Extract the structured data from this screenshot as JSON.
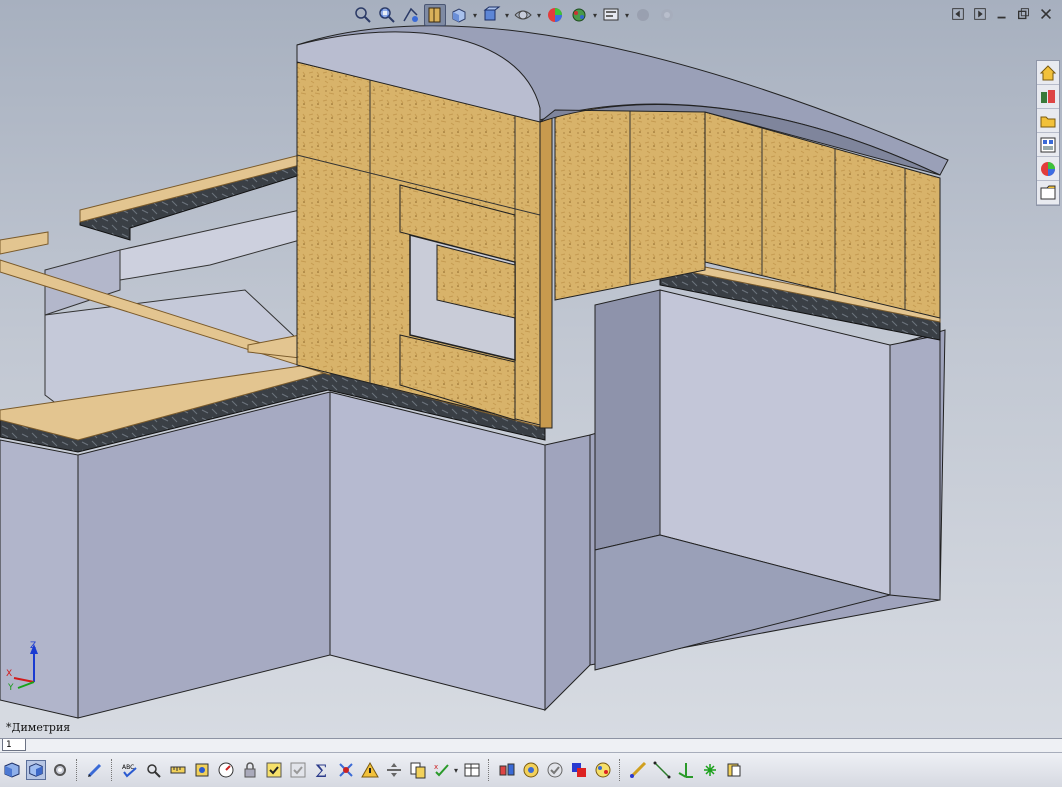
{
  "viewport": {
    "view_label": "*Диметрия",
    "triad": {
      "z": "Z",
      "x": "X",
      "y": "Y"
    }
  },
  "heads_up_toolbar": [
    {
      "icon": "zoom-to-fit-icon"
    },
    {
      "icon": "zoom-to-area-icon"
    },
    {
      "icon": "previous-view-icon"
    },
    {
      "icon": "section-view-icon",
      "active": true
    },
    {
      "icon": "view-orientation-icon",
      "dropdown": true
    },
    {
      "icon": "display-style-icon",
      "dropdown": true
    },
    {
      "icon": "hide-show-items-icon",
      "dropdown": true
    },
    {
      "icon": "edit-appearance-icon"
    },
    {
      "icon": "apply-scene-icon",
      "dropdown": true
    },
    {
      "icon": "view-settings-icon",
      "dropdown": true
    },
    {
      "icon": "realview-icon",
      "disabled": true
    },
    {
      "icon": "shadows-icon",
      "disabled": true
    }
  ],
  "window_controls": [
    "tile-left-icon",
    "tile-right-icon",
    "minimize-icon",
    "restore-icon",
    "close-icon"
  ],
  "task_pane": [
    "home-icon",
    "design-library-icon",
    "file-explorer-icon",
    "view-palette-icon",
    "appearances-icon",
    "custom-properties-icon"
  ],
  "sheet_tabs": [
    {
      "label": "1"
    }
  ],
  "command_bar": [
    {
      "icon": "view-cube-icon"
    },
    {
      "icon": "shaded-view-icon",
      "active": true
    },
    {
      "icon": "gear-view-icon"
    },
    {
      "sep": true
    },
    {
      "icon": "pencil-icon"
    },
    {
      "sep": true
    },
    {
      "icon": "spell-check-icon"
    },
    {
      "icon": "find-icon"
    },
    {
      "icon": "measure-icon"
    },
    {
      "icon": "mass-properties-icon"
    },
    {
      "icon": "statistics-icon"
    },
    {
      "icon": "lock-icon"
    },
    {
      "icon": "check-icon"
    },
    {
      "icon": "check-disabled-icon"
    },
    {
      "icon": "sum-icon"
    },
    {
      "icon": "interference-icon"
    },
    {
      "icon": "warning-icon"
    },
    {
      "icon": "split-icon"
    },
    {
      "icon": "copy-icon"
    },
    {
      "icon": "compare-icon",
      "dropdown": true
    },
    {
      "icon": "table-icon"
    },
    {
      "sep": true
    },
    {
      "icon": "explode-icon"
    },
    {
      "icon": "render-icon"
    },
    {
      "icon": "verify-icon"
    },
    {
      "icon": "color-icon"
    },
    {
      "icon": "palette-icon"
    },
    {
      "sep": true
    },
    {
      "icon": "sketch-line-icon"
    },
    {
      "icon": "line-icon"
    },
    {
      "icon": "axis-icon"
    },
    {
      "icon": "point-icon"
    },
    {
      "icon": "coordinate-icon"
    }
  ],
  "colors": {
    "osb": "#d8b36a",
    "osb_dark": "#c89a4e",
    "concrete_top": "#b4b8cc",
    "concrete_front": "#a9adc4",
    "concrete_side": "#8e93ab",
    "timber": "#e3c590",
    "membrane": "#3a3f45",
    "roof": "#9aa0b8"
  }
}
